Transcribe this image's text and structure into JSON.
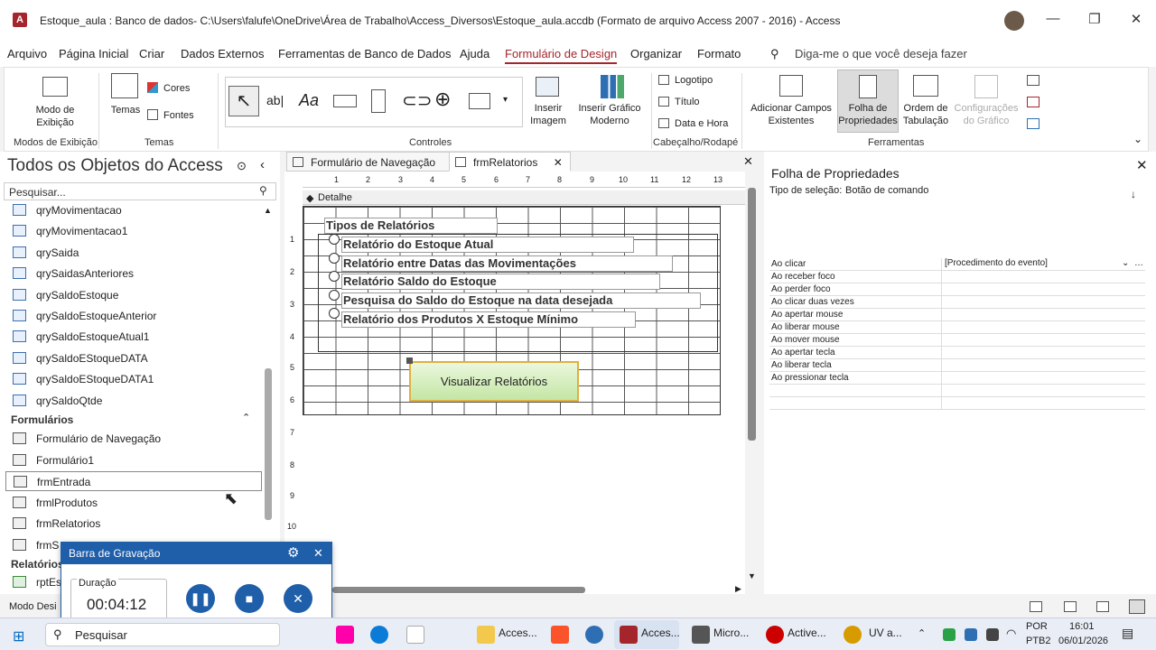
{
  "titlebar": {
    "title": "Estoque_aula : Banco de dados- C:\\Users\\falufe\\OneDrive\\Área de Trabalho\\Access_Diversos\\Estoque_aula.accdb (Formato de arquivo Access 2007 - 2016)  -  Access",
    "app_icon": "A"
  },
  "menu": [
    "Arquivo",
    "Página Inicial",
    "Criar",
    "Dados Externos",
    "Ferramentas de Banco de Dados",
    "Ajuda",
    "Formulário de Design",
    "Organizar",
    "Formato"
  ],
  "tellme": "Diga-me o que você deseja fazer",
  "ribbon": {
    "modo_exibicao": "Modo de\nExibição",
    "temas": "Temas",
    "cores": "Cores",
    "fontes": "Fontes",
    "inserir_imagem": "Inserir\nImagem",
    "inserir_grafico": "Inserir Gráfico\nModerno",
    "logotipo": "Logotipo",
    "titulo": "Título",
    "data_hora": "Data e Hora",
    "adicionar_campos": "Adicionar Campos\nExistentes",
    "folha_prop": "Folha de\nPropriedades",
    "ordem_tab": "Ordem de\nTabulação",
    "config_grafico": "Configurações\ndo Gráfico",
    "groups": {
      "modos": "Modos de Exibição",
      "temas": "Temas",
      "controles": "Controles",
      "cabecalho": "Cabeçalho/Rodapé",
      "ferramentas": "Ferramentas"
    }
  },
  "nav": {
    "header": "Todos os Objetos do Access",
    "search_placeholder": "Pesquisar...",
    "queries": [
      "qryMovimentacao",
      "qryMovimentacao1",
      "qrySaida",
      "qrySaidasAnteriores",
      "qrySaldoEstoque",
      "qrySaldoEstoqueAnterior",
      "qrySaldoEstoqueAtual1",
      "qrySaldoEStoqueDATA",
      "qrySaldoEStoqueDATA1",
      "qrySaldoQtde"
    ],
    "forms_header": "Formulários",
    "forms": [
      "Formulário de Navegação",
      "Formulário1",
      "frmEntrada",
      "frmlProdutos",
      "frmRelatorios",
      "frmS"
    ],
    "reports_header": "Relatórios",
    "reports": [
      "rptEs"
    ]
  },
  "tabs": [
    "Formulário de Navegação",
    "frmRelatorios"
  ],
  "design": {
    "section": "Detalhe",
    "ruler_top": [
      "1",
      "2",
      "3",
      "4",
      "5",
      "6",
      "7",
      "8",
      "9",
      "10",
      "11",
      "12",
      "13"
    ],
    "ruler_left": [
      "1",
      "2",
      "3",
      "4",
      "5",
      "6",
      "7",
      "8",
      "9",
      "10"
    ],
    "group_title": "Tipos de Relatórios",
    "options": [
      "Relatório do Estoque Atual",
      "Relatório entre Datas das Movimentações",
      "Relatório Saldo do Estoque",
      "Pesquisa do Saldo do Estoque na data desejada",
      "Relatório dos Produtos X Estoque Mínimo"
    ],
    "button": "Visualizar Relatórios"
  },
  "props": {
    "title": "Folha de Propriedades",
    "selection_label": "Tipo de seleção:",
    "selection_value": "Botão de comando",
    "rows": [
      {
        "k": "Ao clicar",
        "v": "[Procedimento do evento]"
      },
      {
        "k": "Ao receber foco",
        "v": ""
      },
      {
        "k": "Ao perder foco",
        "v": ""
      },
      {
        "k": "Ao clicar duas vezes",
        "v": ""
      },
      {
        "k": "Ao apertar mouse",
        "v": ""
      },
      {
        "k": "Ao liberar mouse",
        "v": ""
      },
      {
        "k": "Ao mover mouse",
        "v": ""
      },
      {
        "k": "Ao apertar tecla",
        "v": ""
      },
      {
        "k": "Ao liberar tecla",
        "v": ""
      },
      {
        "k": "Ao pressionar tecla",
        "v": ""
      },
      {
        "k": "",
        "v": ""
      },
      {
        "k": "",
        "v": ""
      }
    ]
  },
  "status": {
    "left": "Modo Desi"
  },
  "recorder": {
    "title": "Barra de Gravação",
    "duracao_label": "Duração",
    "time": "00:04:12"
  },
  "taskbar": {
    "search": "Pesquisar",
    "items": [
      "Acces...",
      "Acces...",
      "Micro...",
      "Active...",
      "UV a..."
    ],
    "lang1": "POR",
    "lang2": "PTB2",
    "time": "16:01",
    "date": "06/01/2026"
  }
}
